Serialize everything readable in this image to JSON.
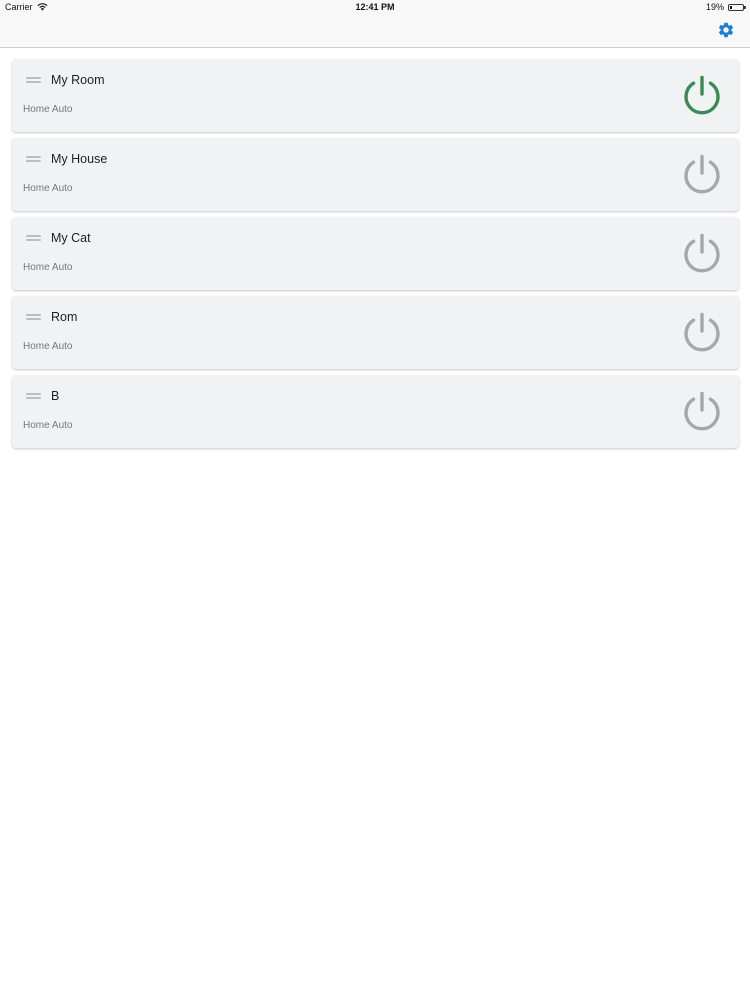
{
  "status_bar": {
    "carrier": "Carrier",
    "time": "12:41 PM",
    "battery": "19%",
    "battery_level": 0.19
  },
  "toolbar": {
    "settings_icon": "gear-icon",
    "accent_color": "#1a7fd1"
  },
  "devices": [
    {
      "name": "My Room",
      "subtitle": "Home Auto",
      "on": true
    },
    {
      "name": "My House",
      "subtitle": "Home Auto",
      "on": false
    },
    {
      "name": "My Cat",
      "subtitle": "Home Auto",
      "on": false
    },
    {
      "name": "Rom",
      "subtitle": "Home Auto",
      "on": false
    },
    {
      "name": "B",
      "subtitle": "Home Auto",
      "on": false
    }
  ],
  "colors": {
    "power_on": "#3a8a55",
    "power_off": "#a7a7a7"
  }
}
